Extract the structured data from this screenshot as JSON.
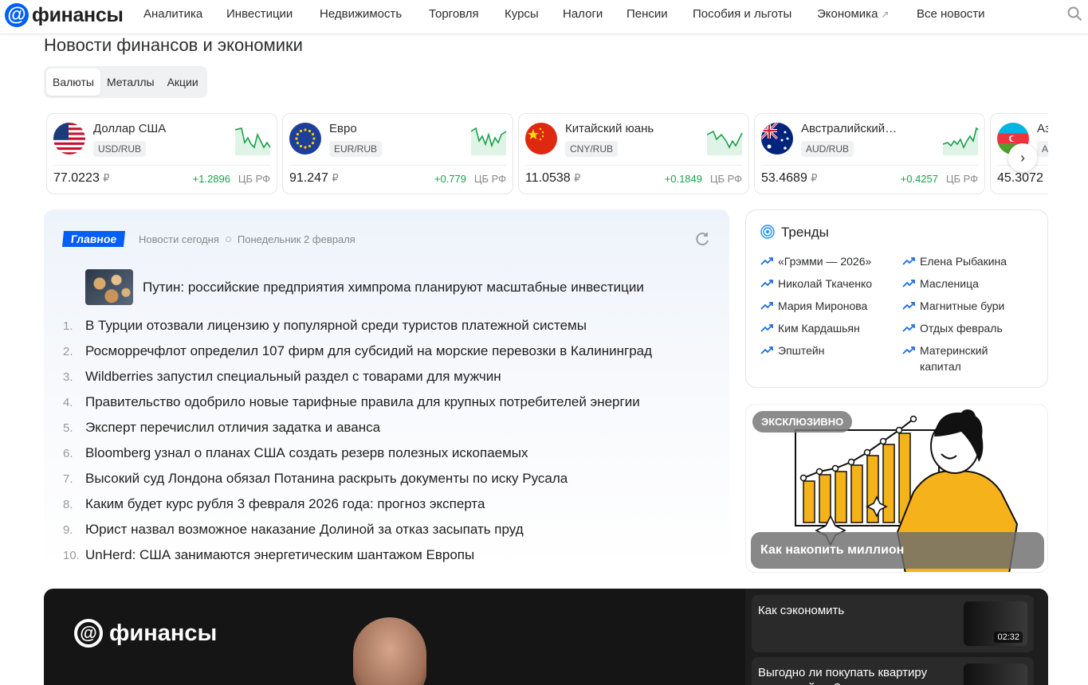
{
  "header": {
    "logo_text": "финансы",
    "nav": [
      "Аналитика",
      "Инвестиции",
      "Недвижимость",
      "Торговля",
      "Курсы",
      "Налоги",
      "Пенсии",
      "Пособия и льготы",
      "Экономика",
      "Все новости"
    ]
  },
  "page_title": "Новости финансов и экономики",
  "tabs": [
    "Валюты",
    "Металлы",
    "Акции"
  ],
  "currencies": [
    {
      "name": "Доллар США",
      "pair": "USD/RUB",
      "value": "77.0223",
      "rub": "₽",
      "change": "+1.2896",
      "source": "ЦБ РФ"
    },
    {
      "name": "Евро",
      "pair": "EUR/RUB",
      "value": "91.247",
      "rub": "₽",
      "change": "+0.779",
      "source": "ЦБ РФ"
    },
    {
      "name": "Китайский юань",
      "pair": "CNY/RUB",
      "value": "11.0538",
      "rub": "₽",
      "change": "+0.1849",
      "source": "ЦБ РФ"
    },
    {
      "name": "Австралийский…",
      "pair": "AUD/RUB",
      "value": "53.4689",
      "rub": "₽",
      "change": "+0.4257",
      "source": "ЦБ РФ"
    },
    {
      "name": "Аз",
      "pair": "A",
      "value": "45.3072",
      "rub": "",
      "change": "",
      "source": ""
    }
  ],
  "news": {
    "badge": "Главное",
    "meta_today": "Новости сегодня",
    "meta_date": "Понедельник 2 февраля",
    "lead": "Путин: российские предприятия химпрома планируют масштабные инвестиции",
    "items": [
      {
        "n": "1.",
        "t": "В Турции отозвали лицензию у популярной среди туристов платежной системы"
      },
      {
        "n": "2.",
        "t": "Росморречфлот определил 107 фирм для субсидий на морские перевозки в Калининград"
      },
      {
        "n": "3.",
        "t": "Wildberries запустил специальный раздел с товарами для мужчин"
      },
      {
        "n": "4.",
        "t": "Правительство одобрило новые тарифные правила для крупных потребителей энергии"
      },
      {
        "n": "5.",
        "t": "Эксперт перечислил отличия задатка и аванса"
      },
      {
        "n": "6.",
        "t": "Bloomberg узнал о планах США создать резерв полезных ископаемых"
      },
      {
        "n": "7.",
        "t": "Высокий суд Лондона обязал Потанина раскрыть документы по иску Русала"
      },
      {
        "n": "8.",
        "t": "Каким будет курс рубля 3 февраля 2026 года: прогноз эксперта"
      },
      {
        "n": "9.",
        "t": "Юрист назвал возможное наказание Долиной за отказ засыпать пруд"
      },
      {
        "n": "10.",
        "t": "UnHerd: США занимаются энергетическим шантажом Европы"
      }
    ]
  },
  "trends": {
    "title": "Тренды",
    "left": [
      "«Грэмми — 2026»",
      "Николай Ткаченко",
      "Мария Миронова",
      "Ким Кардашьян",
      "Эпштейн"
    ],
    "right": [
      "Елена Рыбакина",
      "Масленица",
      "Магнитные бури",
      "Отдых февраль",
      "Материнский капитал"
    ]
  },
  "promo": {
    "badge": "ЭКСКЛЮЗИВНО",
    "caption": "Как накопить миллион"
  },
  "video": {
    "logo_text": "финансы",
    "playlist": [
      {
        "title": "Как сэкономить",
        "duration": "02:32"
      },
      {
        "title": "Выгодно ли покупать квартиру прямо сейчас?",
        "duration": ""
      }
    ]
  }
}
